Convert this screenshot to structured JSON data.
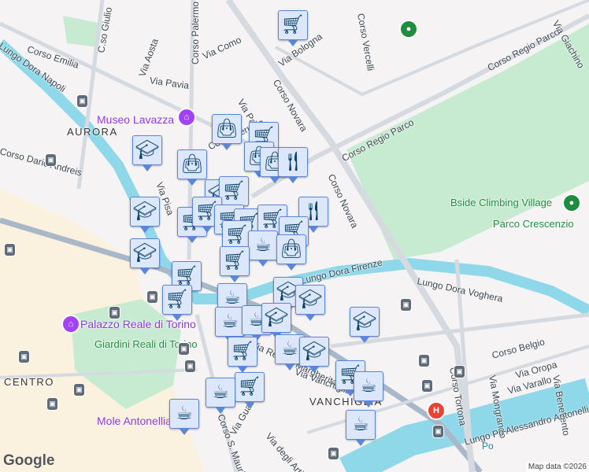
{
  "streets": [
    "Corso Emilia",
    "C.so Giulio",
    "Corso Palermo",
    "Via Como",
    "Via Aosta",
    "Via Pavia",
    "Via Bologna",
    "Corso Novara",
    "Via Padova",
    "Corso Regio Parco",
    "Corso Regio Parco",
    "Corso Novara",
    "Via Pisa",
    "Lungo Dora Firenze",
    "Lungo Dora Voghera",
    "Corso Belgio",
    "Via Oropa",
    "Via Varallo",
    "Via Mongrando",
    "Via Benevento",
    "Corso Tortona",
    "Lungo Po Alessandro Antonelli",
    "Via Guastalla",
    "Via degli Artisti",
    "Corso S. Maurizio",
    "Lungo Dora Napoli",
    "Corso Vercelli",
    "Via Giachino",
    "Corso Perugia",
    "Via Regina Margherita",
    "Via Vanchiglia",
    "Corso Dario Andreis"
  ],
  "areas": [
    "AURORA",
    "CENTRO",
    "VANCHIGLIA"
  ],
  "pois": {
    "museo": "Museo Lavazza",
    "palazzo": "Palazzo Reale di Torino",
    "mole": "Mole Antonelliana",
    "bside": "Bside Climbing Village"
  },
  "parks": {
    "giardini": "Giardini Reali di Torino",
    "parco": "Parco Crescenzio"
  },
  "water": {
    "po": "Po"
  },
  "markers": [
    "cart",
    "bag",
    "cart",
    "bag",
    "bag",
    "fork",
    "grad",
    "bag",
    "grad",
    "cart",
    "grad",
    "cart",
    "fork",
    "cart",
    "cart",
    "cart",
    "cart",
    "cart",
    "cart",
    "coffee",
    "bag",
    "cart",
    "grad",
    "cart",
    "cart",
    "coffee",
    "grad",
    "grad",
    "coffee",
    "coffee",
    "grad",
    "grad",
    "cart",
    "coffee",
    "grad",
    "cart",
    "coffee",
    "cart",
    "coffee",
    "coffee",
    "coffee"
  ],
  "attribution": {
    "logo": "Google",
    "data": "Map data ©2026"
  },
  "colors": {
    "marker_bg": "#dde7fb",
    "marker_border": "#5b86d9",
    "marker_icon": "#0b4368",
    "river": "#8fd8ea",
    "park": "#c7ebd1"
  }
}
